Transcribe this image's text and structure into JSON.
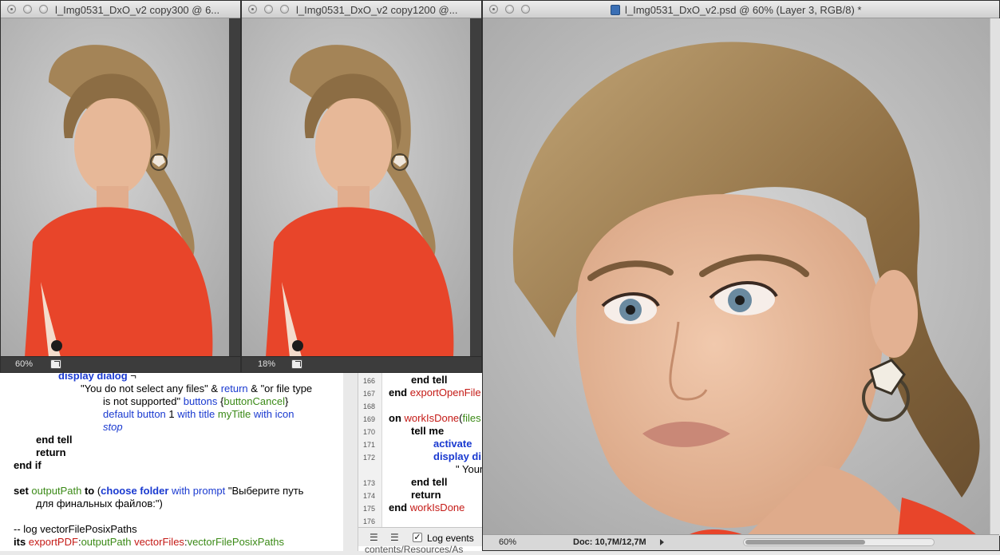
{
  "left_editor": {
    "lines": [
      {
        "parts": [
          {
            "t": "display dialog",
            "c": "kwb"
          },
          {
            "t": " ¬",
            "c": ""
          }
        ]
      },
      {
        "parts": [
          {
            "t": "\"You do not select any files\" & ",
            "c": ""
          },
          {
            "t": "return",
            "c": "blue"
          },
          {
            "t": " & \"or file type",
            "c": ""
          }
        ]
      },
      {
        "parts": [
          {
            "t": "is not supported\" ",
            "c": ""
          },
          {
            "t": "buttons",
            "c": "blue"
          },
          {
            "t": " {",
            "c": ""
          },
          {
            "t": "buttonCancel",
            "c": "green"
          },
          {
            "t": "}",
            "c": ""
          }
        ]
      },
      {
        "parts": [
          {
            "t": "default button",
            "c": "blue"
          },
          {
            "t": " 1 ",
            "c": ""
          },
          {
            "t": "with title",
            "c": "blue"
          },
          {
            "t": " ",
            "c": ""
          },
          {
            "t": "myTitle",
            "c": "green"
          },
          {
            "t": " ",
            "c": ""
          },
          {
            "t": "with icon",
            "c": "blue"
          }
        ]
      },
      {
        "parts": [
          {
            "t": "stop",
            "c": "blue italic"
          }
        ]
      },
      {
        "parts": [
          {
            "t": "end tell",
            "c": "kw"
          }
        ]
      },
      {
        "parts": [
          {
            "t": "return",
            "c": "kw"
          }
        ]
      },
      {
        "parts": [
          {
            "t": "end if",
            "c": "kw"
          }
        ]
      },
      {
        "parts": []
      },
      {
        "parts": [
          {
            "t": "set",
            "c": "kw"
          },
          {
            "t": " ",
            "c": ""
          },
          {
            "t": "outputPath",
            "c": "green"
          },
          {
            "t": " ",
            "c": ""
          },
          {
            "t": "to",
            "c": "kw"
          },
          {
            "t": " (",
            "c": ""
          },
          {
            "t": "choose folder",
            "c": "kwb"
          },
          {
            "t": " ",
            "c": ""
          },
          {
            "t": "with prompt",
            "c": "blue"
          },
          {
            "t": " \"Выберите путь",
            "c": ""
          }
        ]
      },
      {
        "parts": [
          {
            "t": "для финальных файлов:\")",
            "c": ""
          }
        ]
      },
      {
        "parts": []
      },
      {
        "parts": [
          {
            "t": "-- log vectorFilePosixPaths",
            "c": ""
          }
        ]
      },
      {
        "parts": [
          {
            "t": "its",
            "c": "kw"
          },
          {
            "t": " ",
            "c": ""
          },
          {
            "t": "exportPDF",
            "c": "red"
          },
          {
            "t": ":",
            "c": ""
          },
          {
            "t": "outputPath",
            "c": "green"
          },
          {
            "t": " ",
            "c": ""
          },
          {
            "t": "vectorFiles",
            "c": "red"
          },
          {
            "t": ":",
            "c": ""
          },
          {
            "t": "vectorFilePosixPaths",
            "c": "green"
          }
        ]
      }
    ]
  },
  "right_editor": {
    "line_numbers": [
      "166",
      "167",
      "168",
      "169",
      "170",
      "171",
      "172",
      "",
      "173",
      "174",
      "175",
      "176"
    ],
    "lines": [
      {
        "parts": [
          {
            "t": "end tell",
            "c": "kw"
          }
        ]
      },
      {
        "parts": [
          {
            "t": "end",
            "c": "kw"
          },
          {
            "t": " ",
            "c": ""
          },
          {
            "t": "exportOpenFile",
            "c": "red"
          }
        ]
      },
      {
        "parts": []
      },
      {
        "parts": [
          {
            "t": "on",
            "c": "kw"
          },
          {
            "t": " ",
            "c": ""
          },
          {
            "t": "workIsDone",
            "c": "red"
          },
          {
            "t": "(",
            "c": ""
          },
          {
            "t": "files",
            "c": "green"
          }
        ]
      },
      {
        "parts": [
          {
            "t": "tell me",
            "c": "kw"
          }
        ]
      },
      {
        "parts": [
          {
            "t": "activate",
            "c": "kwb"
          }
        ]
      },
      {
        "parts": [
          {
            "t": "display di",
            "c": "kwb"
          }
        ]
      },
      {
        "parts": [
          {
            "t": "\" Your",
            "c": ""
          }
        ]
      },
      {
        "parts": [
          {
            "t": "end tell",
            "c": "kw"
          }
        ]
      },
      {
        "parts": [
          {
            "t": "return",
            "c": "kw"
          }
        ]
      },
      {
        "parts": [
          {
            "t": "end",
            "c": "kw"
          },
          {
            "t": " ",
            "c": ""
          },
          {
            "t": "workIsDone",
            "c": "red"
          }
        ]
      },
      {
        "parts": []
      }
    ],
    "log_events_label": "Log events",
    "partial_path_text": "contents/Resources/As"
  },
  "windows": {
    "w1": {
      "title": "l_Img0531_DxO_v2 copy300 @ 6...",
      "zoom": "60%"
    },
    "w2": {
      "title": "l_Img0531_DxO_v2 copy1200 @...",
      "zoom": "18%"
    },
    "w3": {
      "title": "l_Img0531_DxO_v2.psd @ 60% (Layer 3, RGB/8) *",
      "zoom": "60%",
      "doc_info": "Doc: 10,7M/12,7M"
    }
  },
  "colors": {
    "jacket": "#e8452a",
    "hair": "#9c7a4f",
    "skin": "#e9b89a"
  },
  "icons": {
    "document": "psd-document-icon",
    "share": "share-icon",
    "close": "close-icon"
  }
}
